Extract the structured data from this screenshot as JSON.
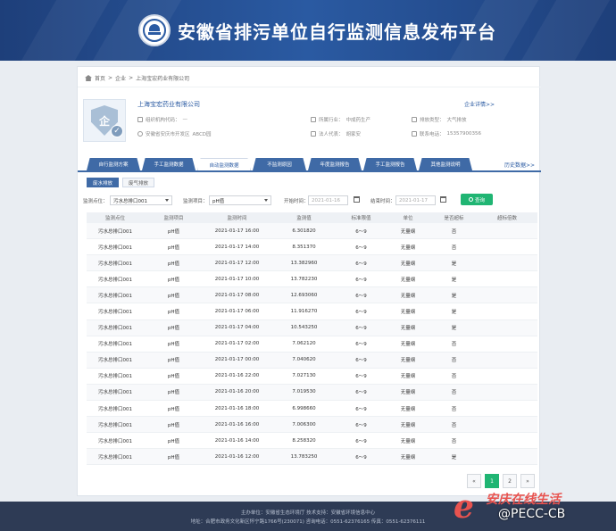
{
  "site": {
    "title": "安徽省排污单位自行监测信息发布平台"
  },
  "breadcrumb": {
    "home": "首页",
    "sep1": ">",
    "level1": "企业",
    "sep2": ">",
    "current": "上海宝宏药业有限公司"
  },
  "company": {
    "name": "上海宝宏药业有限公司",
    "detail_link": "企业详情>>",
    "fields": [
      {
        "label": "组织机构代码：",
        "value": "—"
      },
      {
        "label": "所属行业：",
        "value": "中成药生产"
      },
      {
        "label": "排放类型：",
        "value": "大气排放"
      },
      {
        "label": "安徽省安庆市开发区",
        "value": "ABCD园"
      },
      {
        "label": "法人代表：",
        "value": "胡家安"
      },
      {
        "label": "联系电话：",
        "value": "15357900356"
      }
    ]
  },
  "tabs": [
    "自行监测方案",
    "手工监测数据",
    "自动监测数据",
    "不监测原因",
    "年度监测报告",
    "手工监测报告",
    "其他监测说明"
  ],
  "active_tab": 2,
  "history_link": "历史数据>>",
  "subtabs": [
    "废水排放",
    "废气排放"
  ],
  "active_subtab": 0,
  "filters": {
    "outlet_label": "监测点位：",
    "outlet_value": "污水总排口001",
    "item_label": "监测项目：",
    "item_value": "pH值",
    "start_label": "开始时间：",
    "start_value": "2021-01-16",
    "end_label": "结束时间：",
    "end_value": "2021-01-17",
    "query": "查询"
  },
  "table": {
    "headers": [
      "监测点位",
      "监测项目",
      "监测时间",
      "监测值",
      "标准限值",
      "单位",
      "是否超标",
      "超标倍数"
    ],
    "rows": [
      [
        "污水总排口001",
        "pH值",
        "2021-01-17 16:00",
        "6.301820",
        "6～9",
        "无量纲",
        "否",
        ""
      ],
      [
        "污水总排口001",
        "pH值",
        "2021-01-17 14:00",
        "8.351370",
        "6～9",
        "无量纲",
        "否",
        ""
      ],
      [
        "污水总排口001",
        "pH值",
        "2021-01-17 12:00",
        "13.382960",
        "6～9",
        "无量纲",
        "是",
        ""
      ],
      [
        "污水总排口001",
        "pH值",
        "2021-01-17 10:00",
        "13.782230",
        "6～9",
        "无量纲",
        "是",
        ""
      ],
      [
        "污水总排口001",
        "pH值",
        "2021-01-17 08:00",
        "12.693060",
        "6～9",
        "无量纲",
        "是",
        ""
      ],
      [
        "污水总排口001",
        "pH值",
        "2021-01-17 06:00",
        "11.916270",
        "6～9",
        "无量纲",
        "是",
        ""
      ],
      [
        "污水总排口001",
        "pH值",
        "2021-01-17 04:00",
        "10.543250",
        "6～9",
        "无量纲",
        "是",
        ""
      ],
      [
        "污水总排口001",
        "pH值",
        "2021-01-17 02:00",
        "7.062120",
        "6～9",
        "无量纲",
        "否",
        ""
      ],
      [
        "污水总排口001",
        "pH值",
        "2021-01-17 00:00",
        "7.040620",
        "6～9",
        "无量纲",
        "否",
        ""
      ],
      [
        "污水总排口001",
        "pH值",
        "2021-01-16 22:00",
        "7.027130",
        "6～9",
        "无量纲",
        "否",
        ""
      ],
      [
        "污水总排口001",
        "pH值",
        "2021-01-16 20:00",
        "7.019530",
        "6～9",
        "无量纲",
        "否",
        ""
      ],
      [
        "污水总排口001",
        "pH值",
        "2021-01-16 18:00",
        "6.998660",
        "6～9",
        "无量纲",
        "否",
        ""
      ],
      [
        "污水总排口001",
        "pH值",
        "2021-01-16 16:00",
        "7.006300",
        "6～9",
        "无量纲",
        "否",
        ""
      ],
      [
        "污水总排口001",
        "pH值",
        "2021-01-16 14:00",
        "8.258320",
        "6～9",
        "无量纲",
        "否",
        ""
      ],
      [
        "污水总排口001",
        "pH值",
        "2021-01-16 12:00",
        "13.783250",
        "6～9",
        "无量纲",
        "是",
        ""
      ]
    ]
  },
  "pager": {
    "prev": "«",
    "pages": [
      "1",
      "2"
    ],
    "active": 0,
    "next": "»"
  },
  "footer": {
    "line1": "主办单位：安徽省生态环境厅  技术支持：安徽省环境信息中心",
    "line2": "地址：合肥市政务文化新区怀宁路1766号(230071)  咨询电话：0551-62376165  传真：0551-62376111"
  },
  "watermark": {
    "cn": "安庆在线生活",
    "text": "@PECC-CB"
  },
  "colors": {
    "header": "#2a5aa2",
    "tab": "#3f6aa6",
    "accent": "#20b573",
    "watermark": "#e8534f"
  }
}
